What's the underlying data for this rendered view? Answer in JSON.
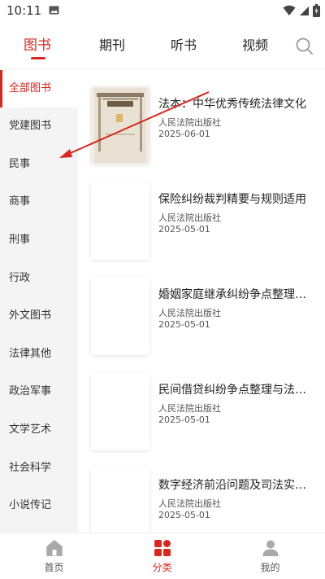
{
  "status_bar": {
    "time": "10:11"
  },
  "tabs": [
    {
      "label": "图书"
    },
    {
      "label": "期刊"
    },
    {
      "label": "听书"
    },
    {
      "label": "视频"
    }
  ],
  "sidebar": {
    "items": [
      {
        "label": "全部图书"
      },
      {
        "label": "党建图书"
      },
      {
        "label": "民事"
      },
      {
        "label": "商事"
      },
      {
        "label": "刑事"
      },
      {
        "label": "行政"
      },
      {
        "label": "外文图书"
      },
      {
        "label": "法律其他"
      },
      {
        "label": "政治军事"
      },
      {
        "label": "文学艺术"
      },
      {
        "label": "社会科学"
      },
      {
        "label": "小说传记"
      }
    ]
  },
  "books": [
    {
      "title": "法本：中华优秀传统法律文化",
      "publisher": "人民法院出版社",
      "date": "2025-06-01"
    },
    {
      "title": "保险纠纷裁判精要与规则适用",
      "publisher": "人民法院出版社",
      "date": "2025-05-01"
    },
    {
      "title": "婚姻家庭继承纠纷争点整理与法律适用",
      "publisher": "人民法院出版社",
      "date": "2025-05-01"
    },
    {
      "title": "民间借贷纠纷争点整理与法律适用",
      "publisher": "人民法院出版社",
      "date": "2025-05-01"
    },
    {
      "title": "数字经济前沿问题及司法实务研究",
      "publisher": "人民法院出版社",
      "date": "2025-05-01"
    }
  ],
  "bottom_nav": [
    {
      "label": "首页"
    },
    {
      "label": "分类"
    },
    {
      "label": "我的"
    }
  ],
  "colors": {
    "accent": "#d8281e",
    "sidebar_bg": "#f4f4f4",
    "icon_gray": "#a9a9a9"
  }
}
